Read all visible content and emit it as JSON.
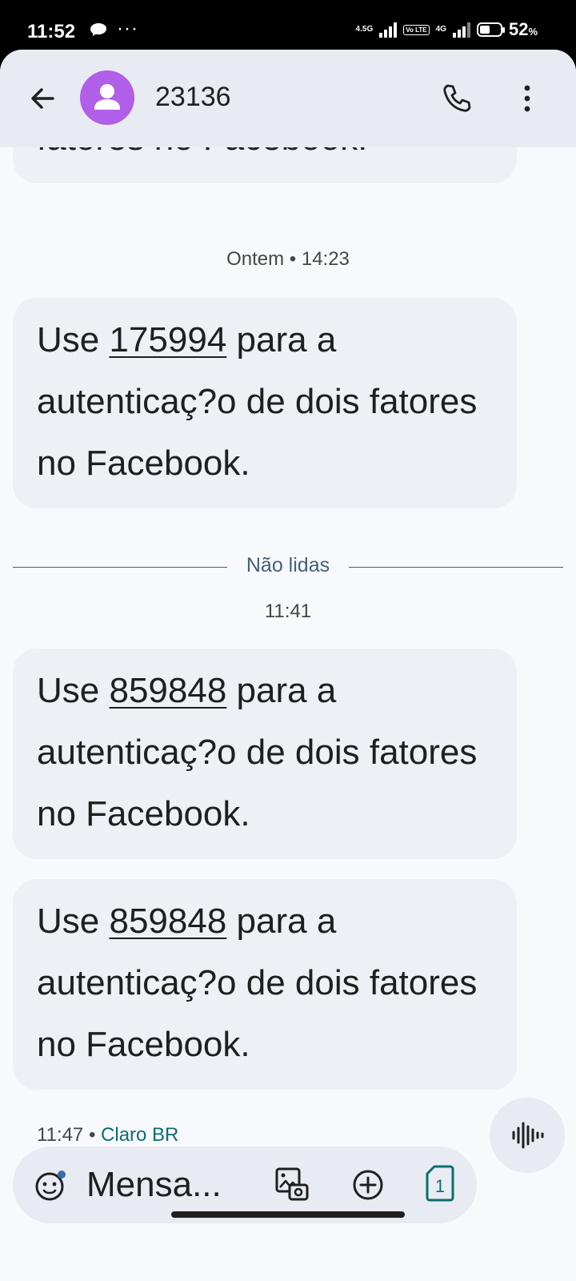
{
  "status_bar": {
    "time": "11:52",
    "dots": "···",
    "net1": "4.5G",
    "volte": "Vo LTE",
    "net2": "4G",
    "battery_percent": "52",
    "battery_unit": "%",
    "battery_level": 0.52
  },
  "header": {
    "contact": "23136"
  },
  "messages": [
    {
      "pre": "",
      "code": "",
      "post": "fatores no Facebook."
    },
    {
      "pre": "Use ",
      "code": "175994",
      "post": " para a autenticaç?o de dois fatores no Facebook."
    },
    {
      "pre": "Use ",
      "code": "859848",
      "post": " para a autenticaç?o de dois fatores no Facebook."
    },
    {
      "pre": "Use ",
      "code": "859848",
      "post": " para a autenticaç?o de dois fatores no Facebook."
    }
  ],
  "timestamps": {
    "yesterday": "Ontem • 14:23",
    "today": "11:41"
  },
  "unread_label": "Não lidas",
  "last_message_meta": {
    "time": "11:47",
    "separator": " • ",
    "carrier": "Claro BR"
  },
  "composer": {
    "placeholder": "Mensa...",
    "sim_number": "1"
  },
  "colors": {
    "avatar": "#b15ee8",
    "bubble": "#eef0f6",
    "header": "#e9ebf2",
    "carrier": "#0b6e6f",
    "divider": "#42607e"
  }
}
